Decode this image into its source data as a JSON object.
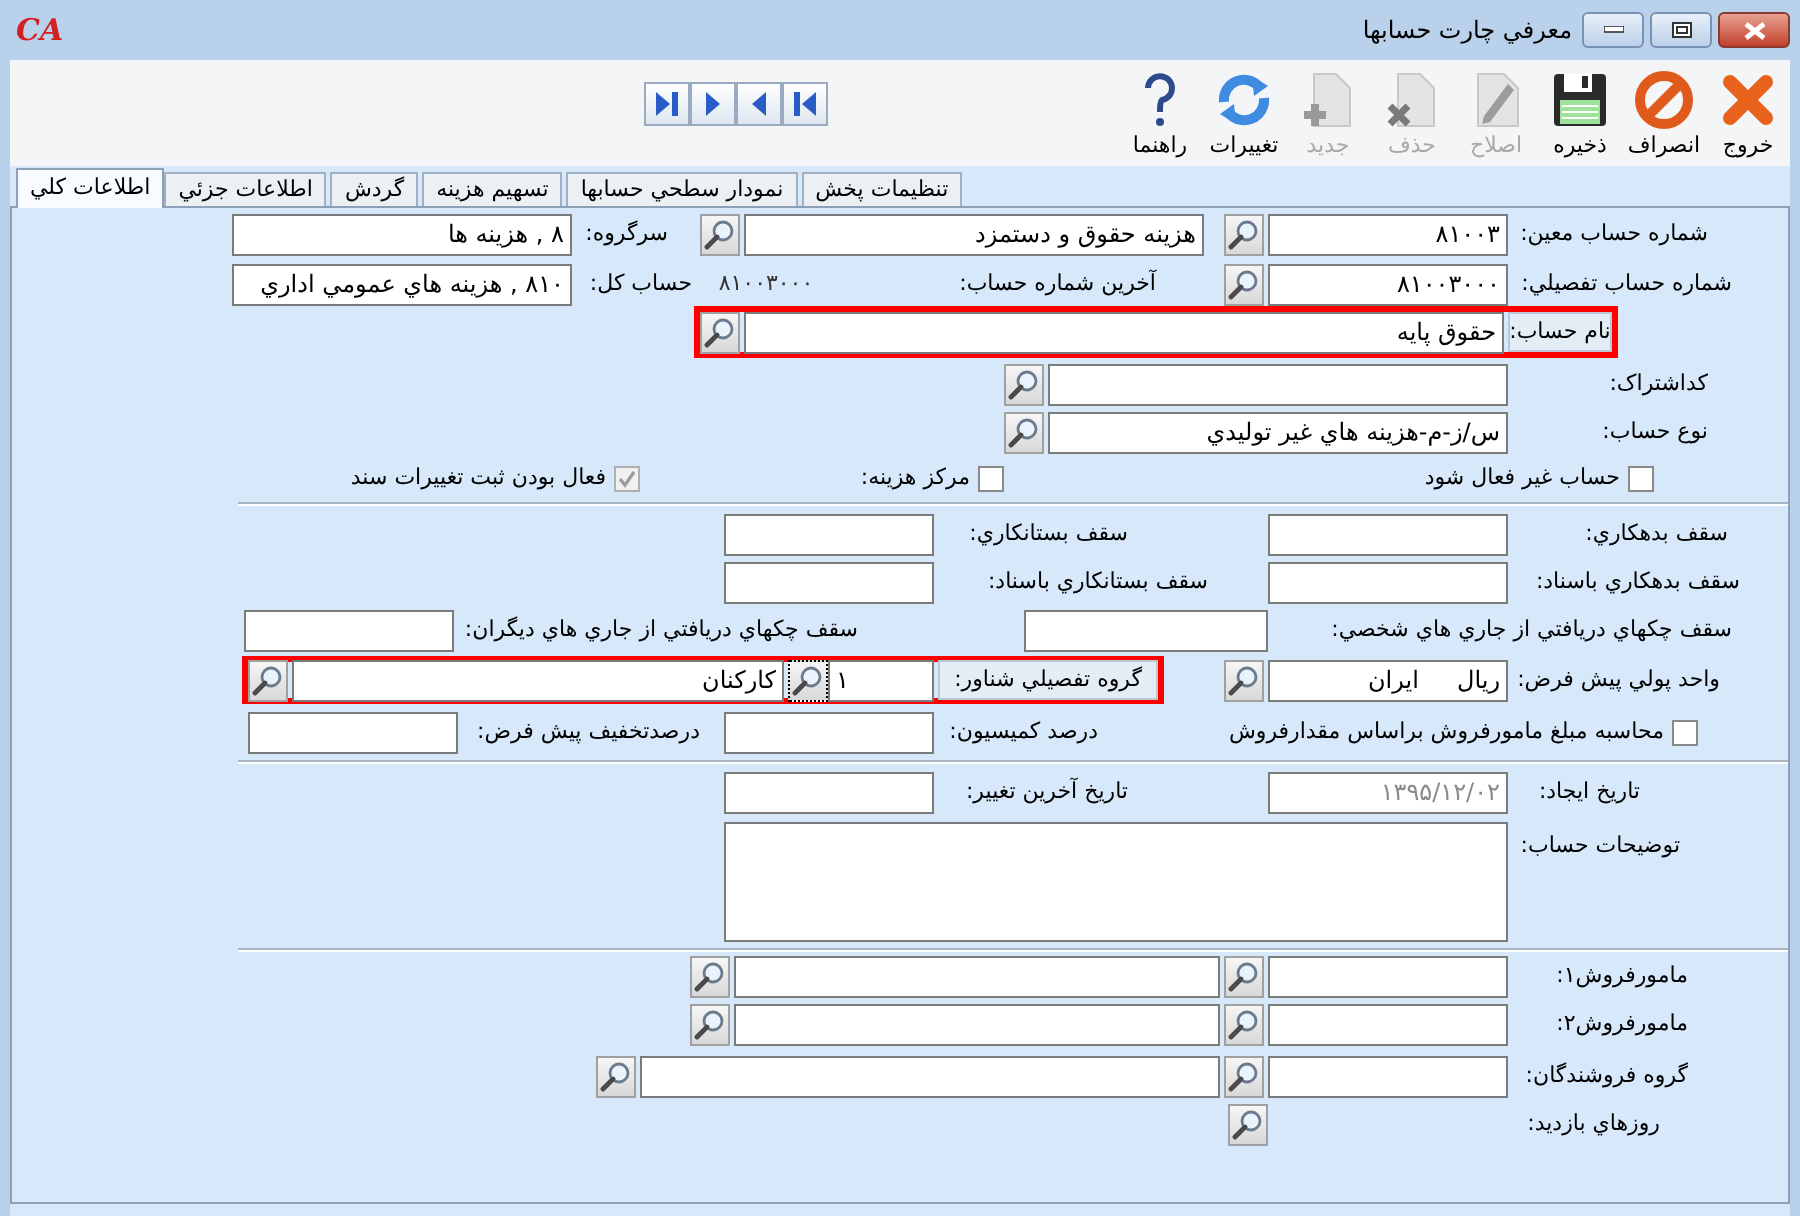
{
  "window": {
    "logo_text": "CA",
    "title": "معرفي چارت حسابها"
  },
  "toolbar": {
    "buttons": [
      {
        "kind": "exit",
        "label": "خروج",
        "disabled": false
      },
      {
        "kind": "cancel",
        "label": "انصراف",
        "disabled": false
      },
      {
        "kind": "save",
        "label": "ذخيره",
        "disabled": false
      },
      {
        "kind": "edit",
        "label": "اصلاح",
        "disabled": true
      },
      {
        "kind": "delete",
        "label": "حذف",
        "disabled": true
      },
      {
        "kind": "new",
        "label": "جديد",
        "disabled": true
      },
      {
        "kind": "refresh",
        "label": "تغييرات",
        "disabled": false
      },
      {
        "kind": "help",
        "label": "راهنما",
        "disabled": false
      }
    ]
  },
  "record_navigation": [
    {
      "kind": "last"
    },
    {
      "kind": "next"
    },
    {
      "kind": "previous"
    },
    {
      "kind": "first"
    }
  ],
  "tabs": [
    {
      "label": "تنظيمات پخش",
      "selected": false
    },
    {
      "label": "نمودار سطحي حسابها",
      "selected": false
    },
    {
      "label": "تسهيم هزينه",
      "selected": false
    },
    {
      "label": "گردش",
      "selected": false
    },
    {
      "label": "اطلاعات جزئي",
      "selected": false
    },
    {
      "label": "اطلاعات کلي",
      "selected": true
    }
  ],
  "form": {
    "rows": [
      {
        "items": [
          {
            "kind": "label",
            "text": "شماره حساب معين:"
          },
          {
            "kind": "field",
            "value": "۸۱۰۰۳"
          },
          {
            "kind": "lookup"
          },
          {
            "kind": "field",
            "value": "هزينه حقوق و دستمزد"
          },
          {
            "kind": "lookup"
          },
          {
            "kind": "label",
            "text": "سرگروه:"
          },
          {
            "kind": "field",
            "value": "۸ , هزينه ها"
          }
        ]
      },
      {
        "items": [
          {
            "kind": "label",
            "text": "شماره حساب تفصيلي:"
          },
          {
            "kind": "field",
            "value": "۸۱۰۰۳۰۰۰"
          },
          {
            "kind": "lookup"
          },
          {
            "kind": "label",
            "text": "آخرين شماره حساب:"
          },
          {
            "kind": "text",
            "text": "۸۱۰۰۳۰۰۰"
          },
          {
            "kind": "label",
            "text": "حساب کل:"
          },
          {
            "kind": "field",
            "value": "۸۱۰ , هزينه هاي عمومي اداري"
          }
        ]
      },
      {
        "items": [
          {
            "kind": "group",
            "highlighted": true,
            "items": [
              {
                "kind": "label_button",
                "text": "نام حساب:"
              },
              {
                "kind": "field",
                "value": "حقوق پايه"
              },
              {
                "kind": "lookup"
              }
            ]
          }
        ]
      },
      {
        "items": [
          {
            "kind": "label",
            "text": "کداشتراک:"
          },
          {
            "kind": "field"
          },
          {
            "kind": "lookup"
          }
        ]
      },
      {
        "items": [
          {
            "kind": "label",
            "text": "نوع حساب:"
          },
          {
            "kind": "field",
            "value": "س/ز-م-هزينه هاي غير توليدي"
          },
          {
            "kind": "lookup"
          }
        ]
      },
      {
        "items": [
          {
            "kind": "checkbox",
            "text": "حساب غير فعال شود",
            "checked": false
          },
          {
            "kind": "checkbox",
            "text": "مرکز هزينه:",
            "checked": false
          },
          {
            "kind": "checkbox",
            "text": "فعال بودن ثبت تغييرات سند",
            "checked": true,
            "disabled": true
          }
        ]
      },
      {
        "items": [
          {
            "kind": "label",
            "text": "سقف بدهکاري:"
          },
          {
            "kind": "field"
          },
          {
            "kind": "label",
            "text": "سقف بستانکاري:"
          },
          {
            "kind": "field"
          }
        ]
      },
      {
        "items": [
          {
            "kind": "label",
            "text": "سقف بدهکاري باسناد:"
          },
          {
            "kind": "field"
          },
          {
            "kind": "label",
            "text": "سقف بستانکاري باسناد:"
          },
          {
            "kind": "field"
          }
        ]
      },
      {
        "items": [
          {
            "kind": "label",
            "text": "سقف چکهاي دريافتي از جاري هاي شخصي:"
          },
          {
            "kind": "field"
          },
          {
            "kind": "label",
            "text": "سقف چکهاي دريافتي از جاري هاي ديگران:"
          },
          {
            "kind": "field"
          }
        ]
      },
      {
        "items": [
          {
            "kind": "label",
            "text": "واحد پولي پيش فرض:"
          },
          {
            "kind": "field",
            "value": "ريال     ايران"
          },
          {
            "kind": "lookup"
          },
          {
            "kind": "group",
            "highlighted": true,
            "items": [
              {
                "kind": "label_button",
                "text": "گروه تفصيلي شناور:"
              },
              {
                "kind": "field",
                "value": "۱"
              },
              {
                "kind": "lookup",
                "focused": true
              },
              {
                "kind": "field",
                "value": "کارکنان"
              },
              {
                "kind": "lookup"
              }
            ]
          }
        ]
      },
      {
        "items": [
          {
            "kind": "checkbox",
            "text": "محاسبه مبلغ مامورفروش براساس مقدارفروش",
            "checked": false
          },
          {
            "kind": "label",
            "text": "درصد کميسيون:"
          },
          {
            "kind": "field"
          },
          {
            "kind": "label",
            "text": "درصدتخفيف پيش فرض:"
          },
          {
            "kind": "field"
          }
        ]
      },
      {
        "items": [
          {
            "kind": "label",
            "text": "تاريخ ايجاد:"
          },
          {
            "kind": "field",
            "value": "۱۳۹۵/۱۲/۰۲",
            "disabled": true
          },
          {
            "kind": "label",
            "text": "تاريخ آخرين تغيير:"
          },
          {
            "kind": "field"
          }
        ]
      },
      {
        "items": [
          {
            "kind": "label",
            "text": "توضيحات حساب:"
          },
          {
            "kind": "textarea"
          }
        ]
      },
      {
        "items": [
          {
            "kind": "label",
            "text": "مامورفروش۱:"
          },
          {
            "kind": "field"
          },
          {
            "kind": "lookup"
          },
          {
            "kind": "field"
          },
          {
            "kind": "lookup"
          }
        ]
      },
      {
        "items": [
          {
            "kind": "label",
            "text": "مامورفروش۲:"
          },
          {
            "kind": "field"
          },
          {
            "kind": "lookup"
          },
          {
            "kind": "field"
          },
          {
            "kind": "lookup"
          }
        ]
      },
      {
        "items": [
          {
            "kind": "label",
            "text": "گروه فروشندگان:"
          },
          {
            "kind": "field"
          },
          {
            "kind": "lookup"
          },
          {
            "kind": "field"
          },
          {
            "kind": "lookup"
          }
        ]
      },
      {
        "items": [
          {
            "kind": "label",
            "text": "روزهاي بازديد:"
          },
          {
            "kind": "lookup"
          }
        ]
      }
    ]
  }
}
